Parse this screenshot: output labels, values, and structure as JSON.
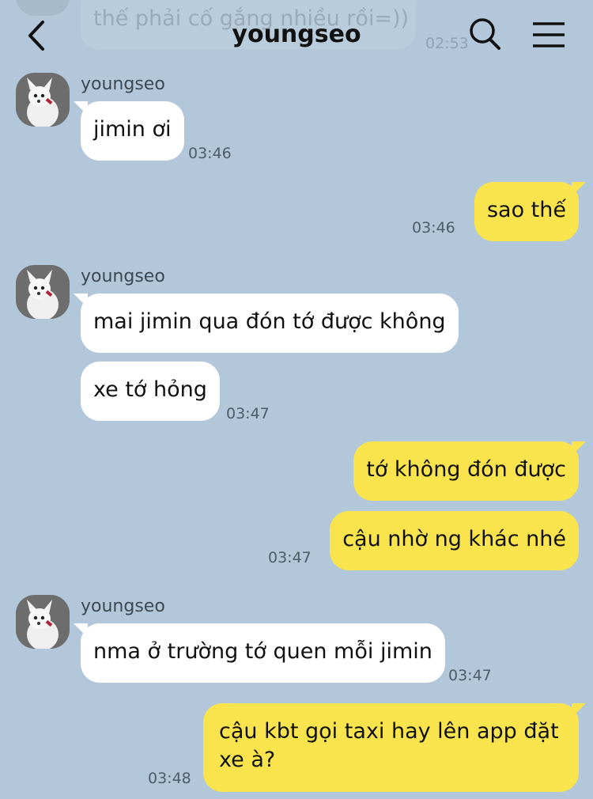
{
  "header": {
    "title": "youngseo",
    "back_icon": "chevron-left-icon",
    "search_icon": "search-icon",
    "menu_icon": "hamburger-menu-icon"
  },
  "previous_message": {
    "text": "thế phải cố gắng nhiều rồi=))",
    "time": "02:53"
  },
  "groups": [
    {
      "sender": "youngseo",
      "messages": [
        "jimin ơi"
      ],
      "time": "03:46"
    },
    {
      "sender": "me",
      "messages": [
        "sao thế"
      ],
      "time": "03:46"
    },
    {
      "sender": "youngseo",
      "messages": [
        "mai jimin qua đón tớ được không",
        "xe tớ hỏng"
      ],
      "time": "03:47"
    },
    {
      "sender": "me",
      "messages": [
        "tớ không đón được",
        "cậu nhờ ng khác nhé"
      ],
      "time": "03:47"
    },
    {
      "sender": "youngseo",
      "messages": [
        "nma ở trường tớ quen mỗi jimin"
      ],
      "time": "03:47"
    },
    {
      "sender": "me",
      "messages": [
        "cậu kbt gọi taxi hay lên app đặt xe à?"
      ],
      "time": "03:48"
    }
  ],
  "colors": {
    "background": "#b2c7d9",
    "incoming_bubble": "#ffffff",
    "outgoing_bubble": "#fae44d"
  }
}
